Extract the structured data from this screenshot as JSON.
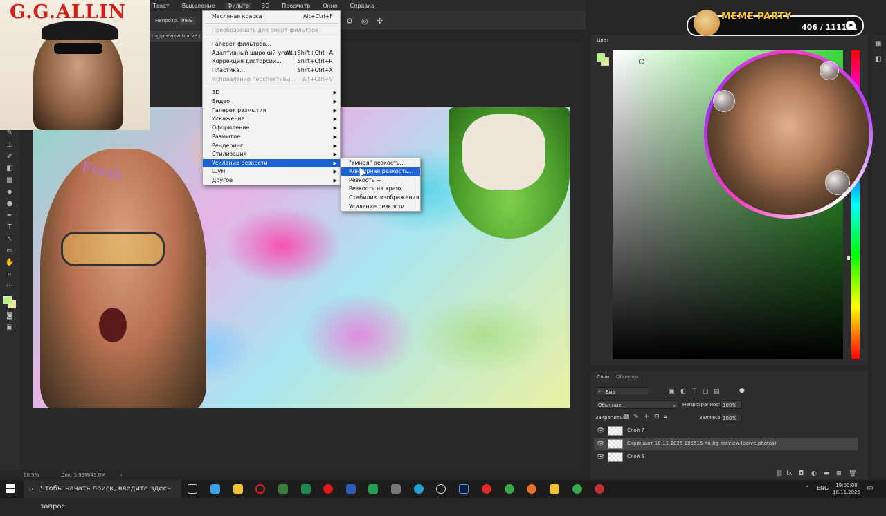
{
  "menubar": {
    "items": [
      "Текст",
      "Выделение",
      "Фильтр",
      "3D",
      "Просмотр",
      "Окно",
      "Справка"
    ],
    "active_index": 2
  },
  "options_bar": {
    "opacity_label": "Непрозр.:",
    "opacity_value": "98%"
  },
  "document_tab": {
    "title": "-bg-preview (carve.ph"
  },
  "filter_menu": {
    "items": [
      {
        "label": "Масляная краска",
        "shortcut": "Alt+Ctrl+F",
        "disabled": false
      },
      {
        "label": "Преобразовать для смарт-фильтров",
        "shortcut": "",
        "disabled": true
      },
      {
        "label": "Галерея фильтров...",
        "shortcut": "",
        "disabled": false
      },
      {
        "label": "Адаптивный широкий угол...",
        "shortcut": "Alt+Shift+Ctrl+A",
        "disabled": false
      },
      {
        "label": "Коррекция дисторсии...",
        "shortcut": "Shift+Ctrl+R",
        "disabled": false
      },
      {
        "label": "Пластика...",
        "shortcut": "Shift+Ctrl+X",
        "disabled": false
      },
      {
        "label": "Исправление перспективы...",
        "shortcut": "Alt+Ctrl+V",
        "disabled": true
      },
      {
        "label": "3D",
        "submenu": true
      },
      {
        "label": "Видео",
        "submenu": true
      },
      {
        "label": "Галерея размытия",
        "submenu": true
      },
      {
        "label": "Искажение",
        "submenu": true
      },
      {
        "label": "Оформление",
        "submenu": true
      },
      {
        "label": "Размытие",
        "submenu": true
      },
      {
        "label": "Рендеринг",
        "submenu": true
      },
      {
        "label": "Стилизация",
        "submenu": true
      },
      {
        "label": "Усиление резкости",
        "submenu": true,
        "selected": true
      },
      {
        "label": "Шум",
        "submenu": true
      },
      {
        "label": "Другое",
        "submenu": true
      }
    ]
  },
  "sharpen_submenu": {
    "items": [
      {
        "label": "\"Умная\" резкость...",
        "selected": false
      },
      {
        "label": "Контурная резкость...",
        "selected": true
      },
      {
        "label": "Резкость +",
        "selected": false
      },
      {
        "label": "Резкость на краях",
        "selected": false
      },
      {
        "label": "Стабилиз. изображения...",
        "selected": false
      },
      {
        "label": "Усиление резкости",
        "selected": false
      }
    ]
  },
  "canvas": {
    "head_text": "Freak"
  },
  "overlay_gg": {
    "title": "G.G.ALLIN"
  },
  "meme_widget": {
    "title": "MEME PARTY",
    "count": "406 / 111111"
  },
  "color_panel": {
    "tab": "Цвет"
  },
  "layers_panel": {
    "tabs": [
      "Слои",
      "Образцы"
    ],
    "kind_filter": "Вид",
    "blend_mode": "Обычные",
    "opacity_label": "Непрозрачность:",
    "opacity_value": "100%",
    "lock_label": "Закрепить:",
    "fill_label": "Заливка:",
    "fill_value": "100%",
    "layers": [
      {
        "name": "Слой 7"
      },
      {
        "name": "Скриншот 18-11-2025 185515-no-bg-preview (carve.photos)"
      },
      {
        "name": "Слой 6"
      }
    ]
  },
  "status_bar": {
    "zoom": "60,5%",
    "doc": "Док: 5,93М/43,0М"
  },
  "taskbar": {
    "search_placeholder": "Чтобы начать поиск, введите здесь запрос",
    "lang": "ENG",
    "time": "19:00:00",
    "date": "18.11.2025"
  },
  "colors": {
    "menu_highlight": "#1a62d0",
    "foreground": "#b7f57a",
    "background": "#e8e890",
    "title_red": "#d0201a",
    "meme_gold": "#f2c230"
  }
}
